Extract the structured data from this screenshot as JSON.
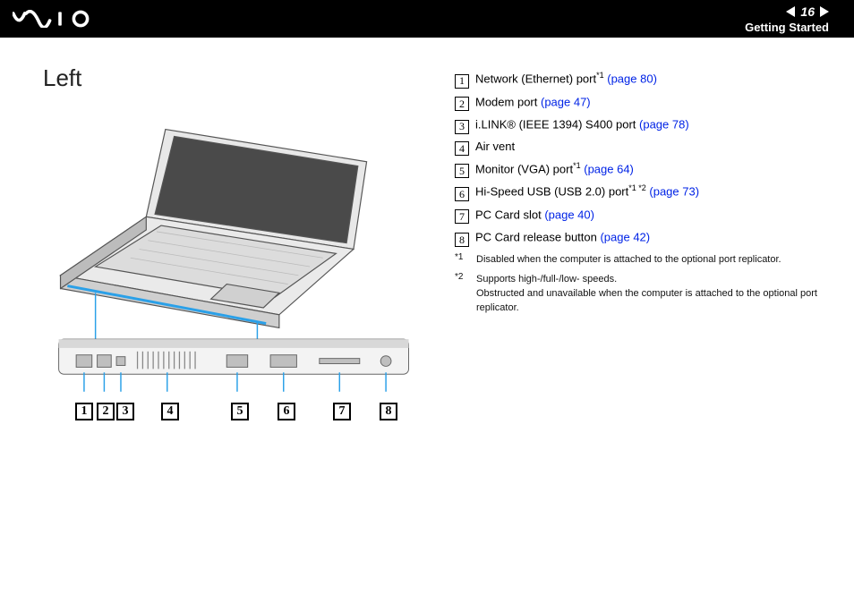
{
  "header": {
    "page_number": "16",
    "section": "Getting Started"
  },
  "title": "Left",
  "legend": [
    {
      "num": "1",
      "label": "Network (Ethernet) port",
      "sup": "*1",
      "link": "(page 80)"
    },
    {
      "num": "2",
      "label": "Modem port ",
      "sup": "",
      "link": "(page 47)"
    },
    {
      "num": "3",
      "label": "i.LINK® (IEEE 1394) S400 port ",
      "sup": "",
      "link": "(page 78)"
    },
    {
      "num": "4",
      "label": "Air vent",
      "sup": "",
      "link": ""
    },
    {
      "num": "5",
      "label": "Monitor (VGA) port",
      "sup": "*1",
      "link": "(page 64)"
    },
    {
      "num": "6",
      "label": "Hi-Speed USB (USB 2.0) port",
      "sup": "*1 *2",
      "link": "(page 73)"
    },
    {
      "num": "7",
      "label": "PC Card slot ",
      "sup": "",
      "link": "(page 40)"
    },
    {
      "num": "8",
      "label": "PC Card release button ",
      "sup": "",
      "link": "(page 42)"
    }
  ],
  "footnotes": [
    {
      "mark": "*1",
      "text": "Disabled when the computer is attached to the optional port replicator."
    },
    {
      "mark": "*2",
      "text": "Supports high-/full-/low- speeds.\nObstructed and unavailable when the computer is attached to the optional port replicator."
    }
  ],
  "diagram_callouts": [
    "1",
    "2",
    "3",
    "4",
    "5",
    "6",
    "7",
    "8"
  ]
}
